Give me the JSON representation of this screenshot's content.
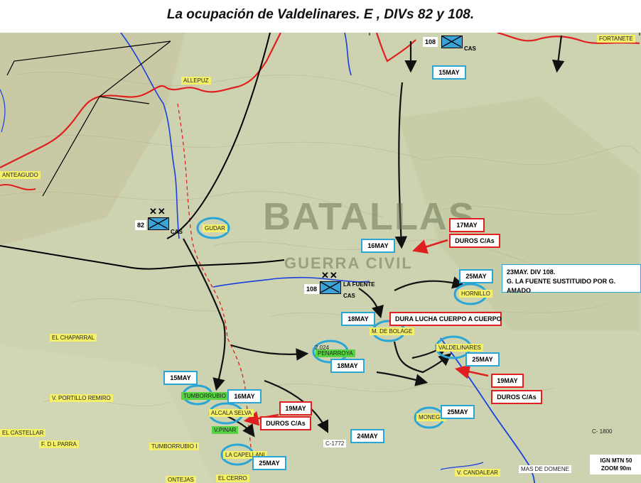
{
  "title": "La ocupación de Valdelinares. E , DIVs 82 y 108.",
  "watermark": {
    "line1": "BATALLAS",
    "line2": "GUERRA CIVIL"
  },
  "colors": {
    "front": "#e02020",
    "river": "#1a3fe0",
    "boundary": "#000000",
    "advance": "#111111",
    "place_label": "#f5f06a",
    "place_label_green": "#57d243",
    "unit": "#3aa3d8",
    "callout_blue": "#2aa6d6",
    "callout_red": "#e02020"
  },
  "units": [
    {
      "number": "108",
      "xx": "✕✕",
      "tag": "CAS"
    },
    {
      "number": "82",
      "xx": "✕✕",
      "tag": "CAS"
    },
    {
      "number": "108",
      "xx": "✕✕",
      "tag": "CAS",
      "commander": "LA FUENTE"
    }
  ],
  "date_boxes": [
    "15MAY",
    "16MAY",
    "25MAY",
    "18MAY",
    "18MAY",
    "25MAY",
    "15MAY",
    "16MAY",
    "25MAY",
    "24MAY",
    "25MAY"
  ],
  "red_boxes": [
    "17MAY",
    "DUROS C/As",
    "DURA LUCHA CUERPO A CUERPO",
    "19MAY",
    "DUROS C/As",
    "19MAY",
    "DUROS C/As"
  ],
  "note": {
    "line1": "23MAY. DIV 108.",
    "line2": "G. LA FUENTE SUSTITUIDO POR G. AMADO"
  },
  "places": [
    "ALLEPUZ",
    "FORTANETE",
    "ANTEAGUDO",
    "GUDAR",
    "HORNILLO",
    "M. DE BOLAGE",
    "VALDELINARES",
    "2.024",
    "PENARROYA",
    "EL CHAPARRAL",
    "TUMBORRUBIO II",
    "V. PORTILLO REMIRO",
    "ALCALA SELVA",
    "V.PINAR",
    "EL CASTELLAR",
    "F. D L PARRA",
    "TUMBORRUBIO I",
    "LA CAPELLANI",
    "ONTEJAS",
    "EL CERRO",
    "MONEGR",
    "C-1772",
    "V. CANDALEAR",
    "MAS DE DOMENE",
    "C- 1800"
  ],
  "scale": {
    "line1": "IGN MTN 50",
    "line2": "ZOOM 90m"
  }
}
